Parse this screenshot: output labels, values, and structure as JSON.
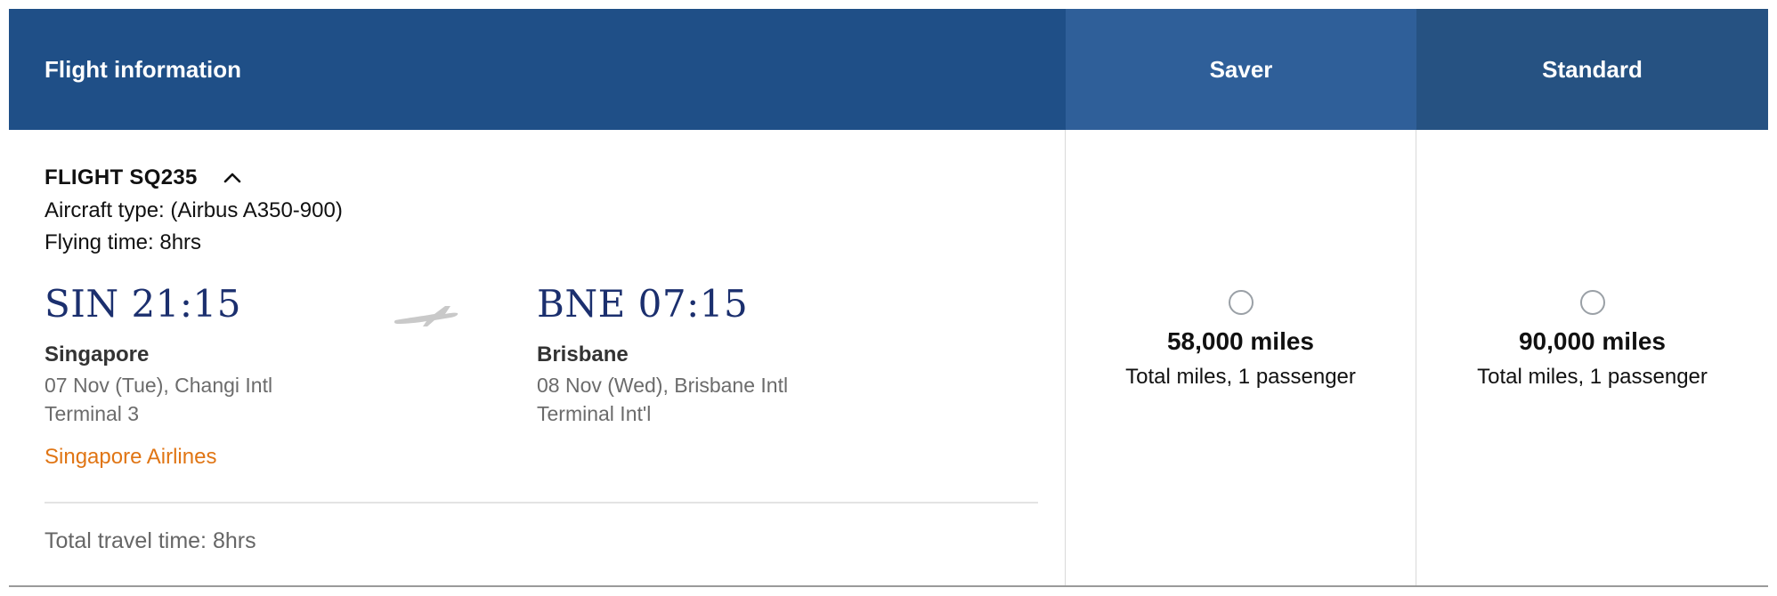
{
  "header": {
    "flight_info": "Flight information",
    "saver": "Saver",
    "standard": "Standard"
  },
  "flight": {
    "number": "FLIGHT SQ235",
    "aircraft": "Aircraft type: (Airbus A350-900)",
    "flying_time": "Flying time: 8hrs",
    "departure": {
      "time": "SIN 21:15",
      "city": "Singapore",
      "date_airport": "07 Nov (Tue), Changi Intl",
      "terminal": "Terminal 3"
    },
    "arrival": {
      "time": "BNE 07:15",
      "city": "Brisbane",
      "date_airport": "08 Nov (Wed), Brisbane Intl",
      "terminal": "Terminal Int'l"
    },
    "airline": "Singapore Airlines",
    "total_travel_time": "Total travel time: 8hrs"
  },
  "fares": {
    "saver": {
      "miles": "58,000 miles",
      "note": "Total miles, 1 passenger",
      "selected": false
    },
    "standard": {
      "miles": "90,000 miles",
      "note": "Total miles, 1 passenger",
      "selected": false
    }
  },
  "colors": {
    "header_info": "#1f4f87",
    "header_saver": "#2f5f99",
    "header_standard": "#265282",
    "time_text": "#1b2f6e",
    "airline_link": "#e07514"
  },
  "icons": {
    "collapse": "chevron-up-icon",
    "flight": "airplane-icon"
  }
}
